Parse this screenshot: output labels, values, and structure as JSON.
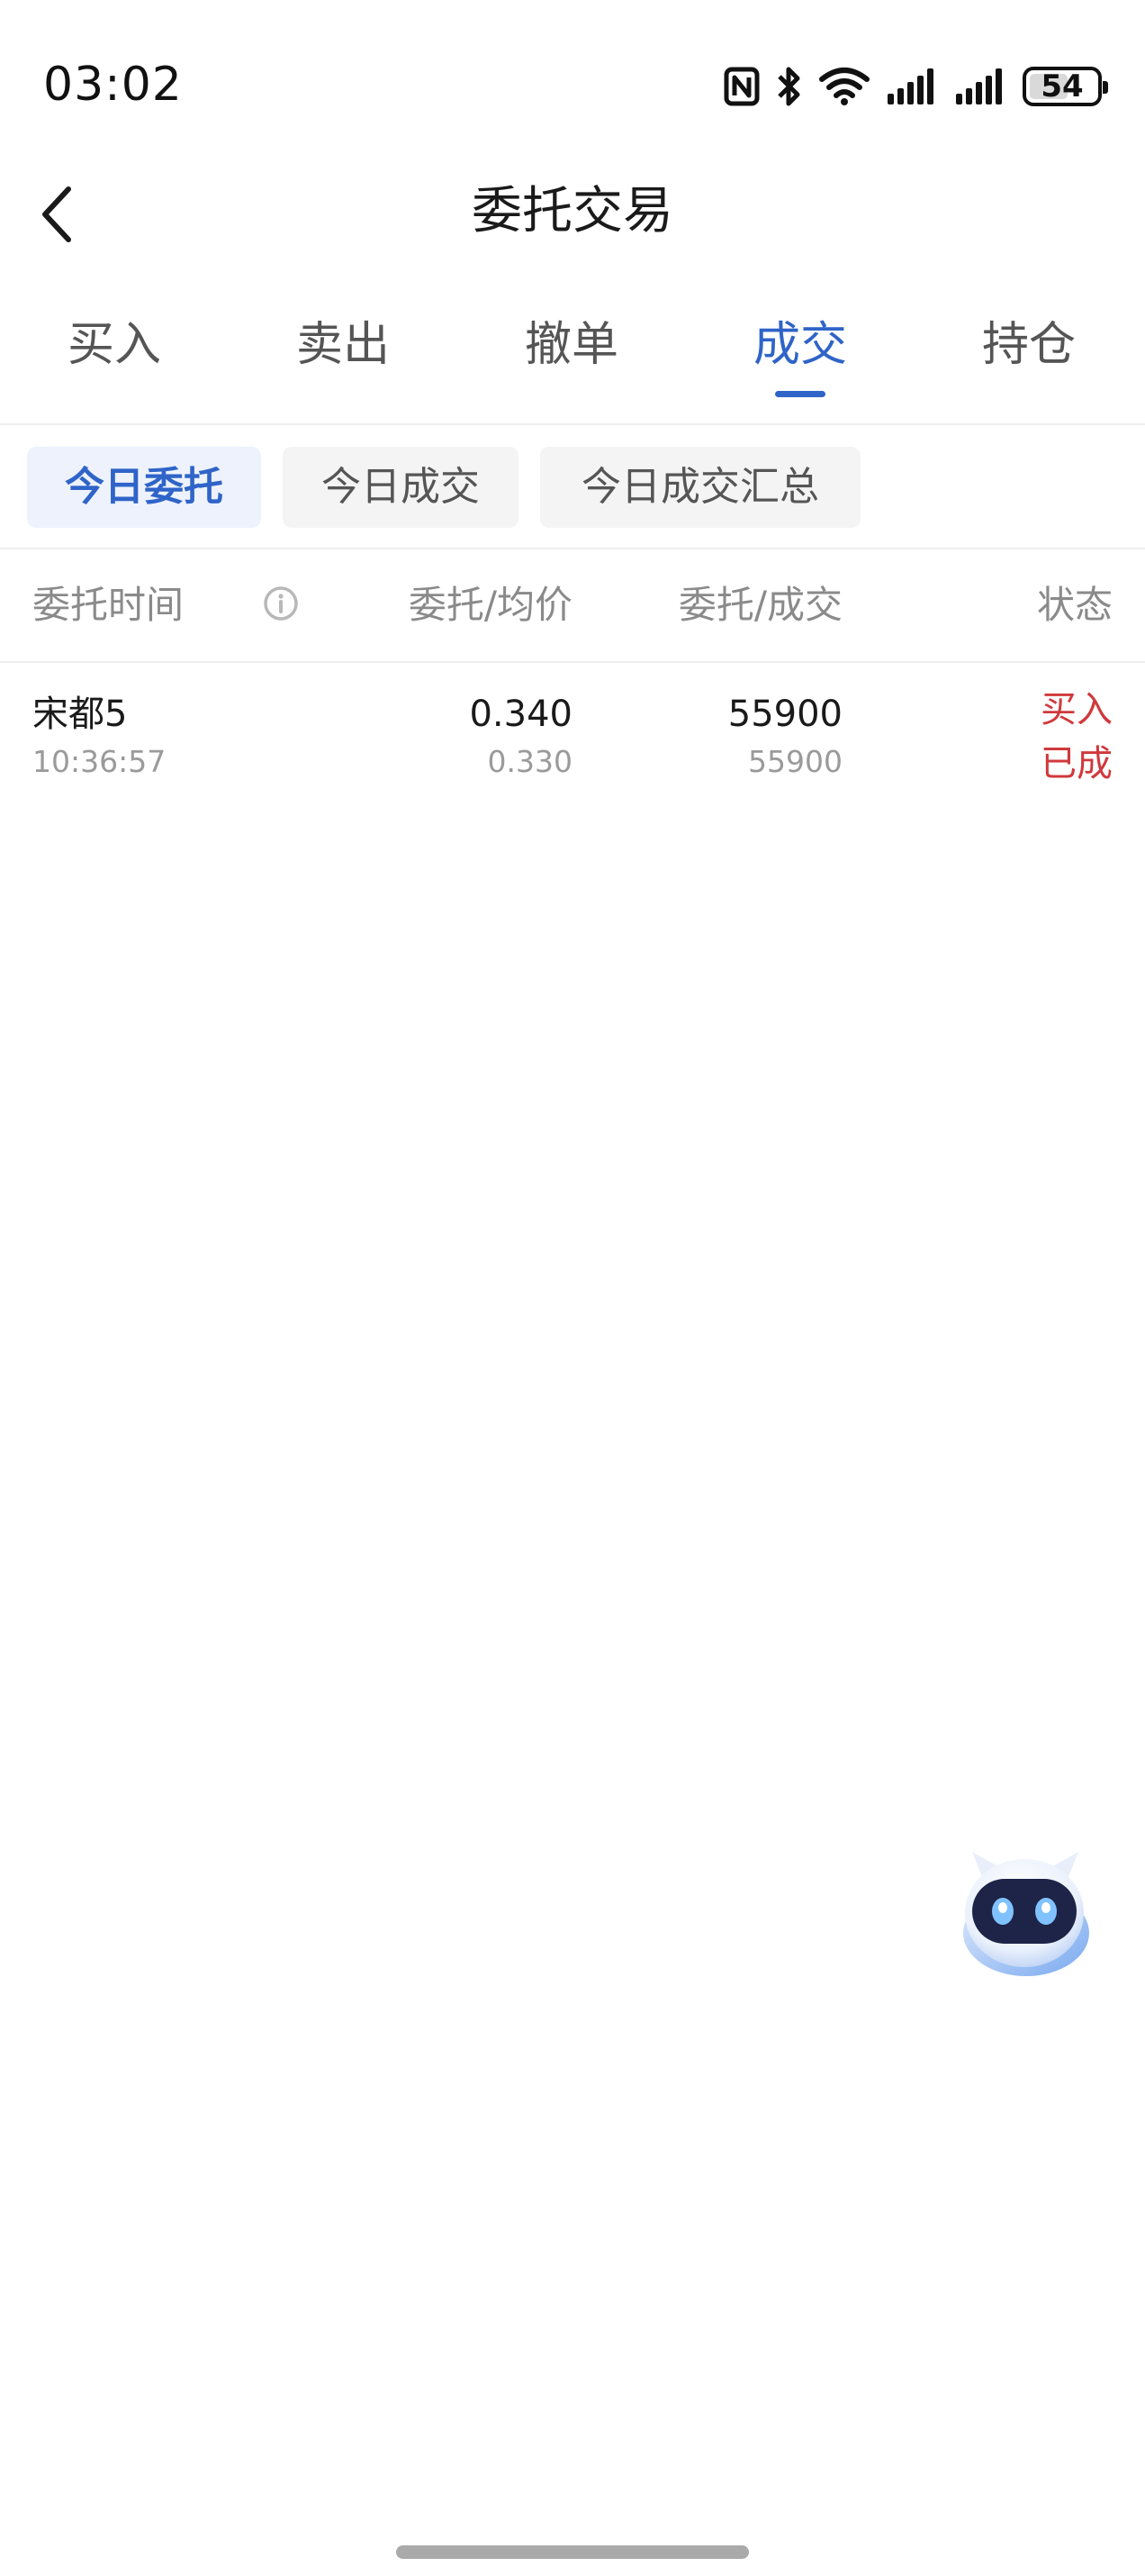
{
  "status_bar": {
    "time": "03:02",
    "battery": "54",
    "icons": [
      "nfc-icon",
      "bluetooth-icon",
      "wifi-icon",
      "signal-icon",
      "signal-icon",
      "battery-icon"
    ]
  },
  "header": {
    "title": "委托交易",
    "back_icon": "chevron-left-icon"
  },
  "main_tabs": [
    {
      "label": "买入",
      "active": false
    },
    {
      "label": "卖出",
      "active": false
    },
    {
      "label": "撤单",
      "active": false
    },
    {
      "label": "成交",
      "active": true
    },
    {
      "label": "持仓",
      "active": false
    }
  ],
  "sub_tabs": [
    {
      "label": "今日委托",
      "active": true
    },
    {
      "label": "今日成交",
      "active": false
    },
    {
      "label": "今日成交汇总",
      "active": false
    }
  ],
  "table": {
    "columns": [
      "委托时间",
      "委托/均价",
      "委托/成交",
      "状态"
    ],
    "info_icon": "info-icon",
    "rows": [
      {
        "name": "宋都5",
        "time": "10:36:57",
        "order_price": "0.340",
        "avg_price": "0.330",
        "order_qty": "55900",
        "filled_qty": "55900",
        "direction": "买入",
        "status": "已成"
      }
    ]
  },
  "colors": {
    "accent": "#2f64c8",
    "buy_status": "#d0393c",
    "secondary_text": "#9a9a9a"
  },
  "assistant": {
    "icon": "robot-assistant-icon"
  }
}
